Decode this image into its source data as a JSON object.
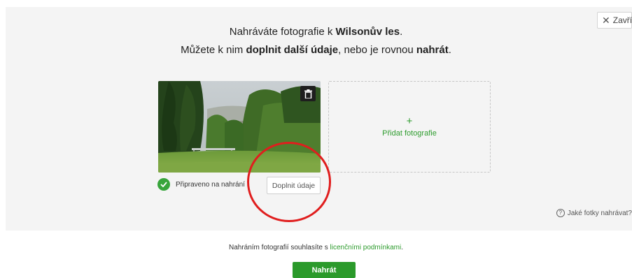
{
  "header": {
    "close_label": "Zavřít",
    "line1_prefix": "Nahráváte fotografie k ",
    "place_name": "Wilsonův les",
    "line1_suffix": ".",
    "line2_a": "Můžete k nim ",
    "line2_b": "doplnit další údaje",
    "line2_c": ", nebo je rovnou ",
    "line2_d": "nahrát",
    "line2_e": "."
  },
  "photo": {
    "status_text": "Připraveno na nahrání",
    "fill_details_label": "Doplnit údaje"
  },
  "add_tile": {
    "plus": "+",
    "label": "Přidat fotografie"
  },
  "help": {
    "label": "Jaké fotky nahrávat?"
  },
  "footer": {
    "consent_prefix": "Nahráním fotografií souhlasíte s ",
    "consent_link": "licenčními podmínkami",
    "consent_suffix": ".",
    "submit_label": "Nahrát"
  },
  "colors": {
    "accent_green": "#2b9a2b",
    "highlight_red": "#e01e1e",
    "panel_bg": "#f4f4f4"
  }
}
